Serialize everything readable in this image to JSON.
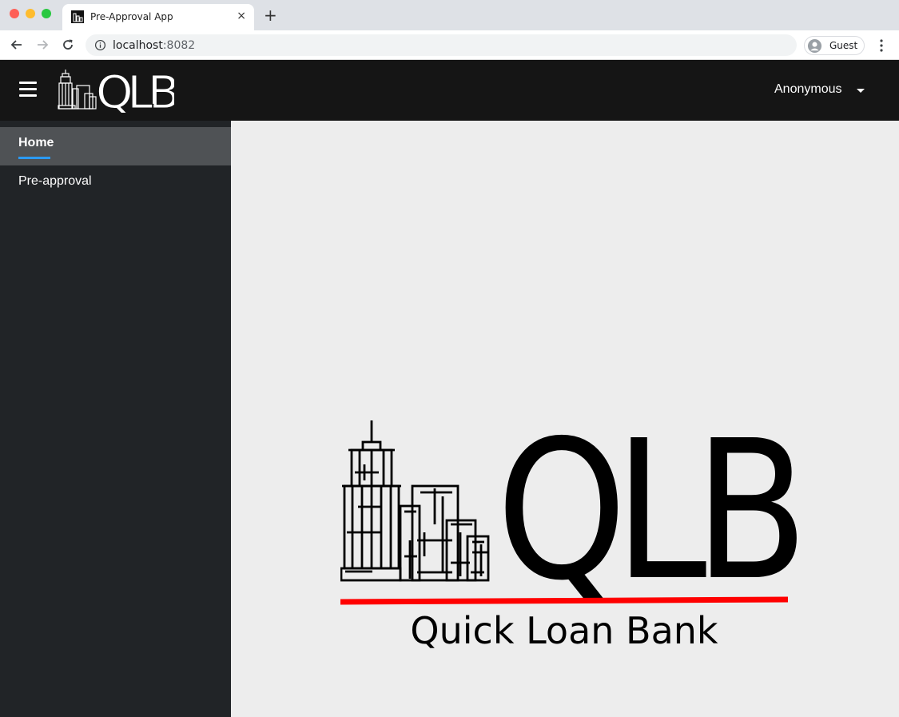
{
  "browser": {
    "tab_title": "Pre-Approval App",
    "tab_close": "×",
    "new_tab": "+",
    "url_host": "localhost",
    "url_port": ":8082",
    "profile_label": "Guest"
  },
  "header": {
    "logo_text": "QLB",
    "user_label": "Anonymous"
  },
  "sidebar": {
    "items": [
      {
        "label": "Home",
        "active": true
      },
      {
        "label": "Pre-approval",
        "active": false
      }
    ]
  },
  "main": {
    "logo_text": "QLB",
    "tagline": "Quick Loan Bank"
  },
  "colors": {
    "header_bg": "#151515",
    "sidebar_bg": "#212427",
    "active_item_bg": "#4f5255",
    "accent": "#2b9af3",
    "tagline_underline": "#ff0000"
  }
}
